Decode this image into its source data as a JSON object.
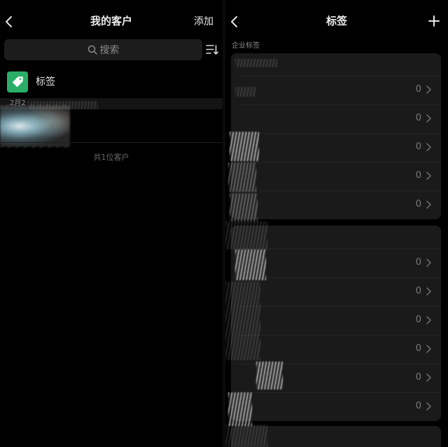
{
  "colors": {
    "background": "#000000",
    "card": "#1a1a1a",
    "accent_green": "#2aae67",
    "muted_text": "#8a8a8a"
  },
  "left": {
    "nav": {
      "back_icon": "chevron-left-icon",
      "title": "我的客户",
      "action_label": "添加"
    },
    "search": {
      "icon": "search-icon",
      "placeholder": "搜索"
    },
    "sort_icon": "sort-icon",
    "tag_entry": {
      "icon": "tag-icon",
      "label": "标签"
    },
    "section_header": "2月2",
    "summary": "共1位客户"
  },
  "right": {
    "nav": {
      "back_icon": "chevron-left-icon",
      "title": "标签",
      "add_icon": "plus-icon"
    },
    "section_label": "企业标签",
    "groups": [
      {
        "rows": [
          {
            "count": "0"
          },
          {
            "count": "0"
          },
          {
            "count": "0"
          },
          {
            "count": "0"
          },
          {
            "count": "0"
          }
        ]
      },
      {
        "rows": [
          {
            "count": "0"
          },
          {
            "count": "0"
          },
          {
            "count": "0"
          },
          {
            "count": "0"
          },
          {
            "count": "0"
          },
          {
            "count": "0"
          }
        ]
      },
      {
        "rows": []
      }
    ]
  }
}
